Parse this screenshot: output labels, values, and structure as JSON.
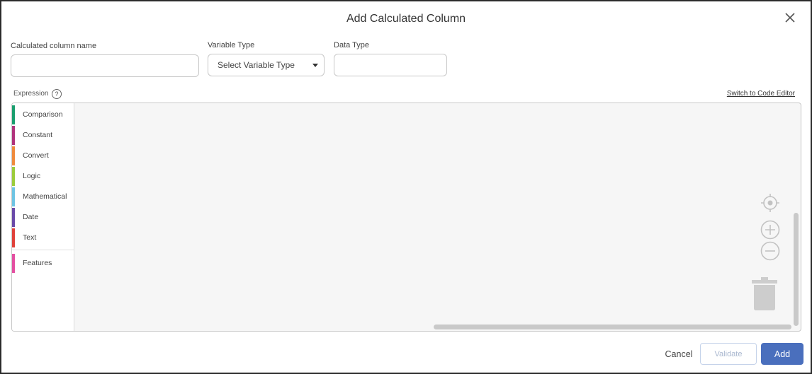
{
  "dialog": {
    "title": "Add Calculated Column"
  },
  "fields": {
    "name_label": "Calculated column name",
    "name_value": "",
    "variable_type_label": "Variable Type",
    "variable_type_selected": "Select Variable Type",
    "data_type_label": "Data Type",
    "data_type_value": ""
  },
  "expression": {
    "label": "Expression",
    "help_glyph": "?",
    "switch_link": "Switch to Code Editor"
  },
  "palette": {
    "items": [
      {
        "label": "Comparison",
        "color": "#1a9e6e"
      },
      {
        "label": "Constant",
        "color": "#b0337c"
      },
      {
        "label": "Convert",
        "color": "#ef8a3c"
      },
      {
        "label": "Logic",
        "color": "#9ccc3b"
      },
      {
        "label": "Mathematical",
        "color": "#6ec4e3"
      },
      {
        "label": "Date",
        "color": "#6a4aa8"
      },
      {
        "label": "Text",
        "color": "#e0413a"
      },
      {
        "label": "Features",
        "color": "#e34fa1"
      }
    ]
  },
  "canvas_tools": [
    "locate-icon",
    "zoom-in-icon",
    "zoom-out-icon",
    "trash-icon"
  ],
  "buttons": {
    "cancel": "Cancel",
    "validate": "Validate",
    "add": "Add"
  },
  "colors": {
    "primary": "#4a6fbd",
    "editor_bg": "#f6f6f6"
  }
}
